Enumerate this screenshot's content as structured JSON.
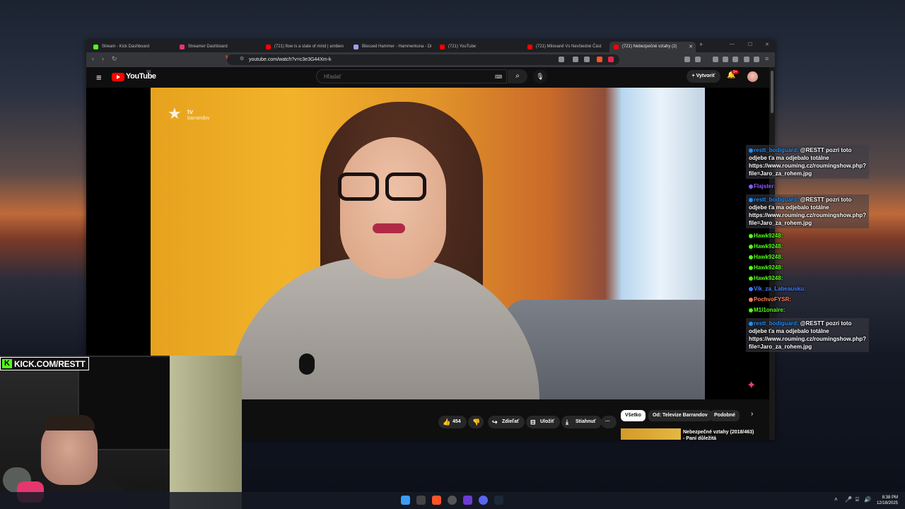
{
  "tabs": [
    {
      "label": "Stream - Kick Dashboard",
      "color": "#53fc18"
    },
    {
      "label": "Streamer Dashboard",
      "color": "#e5366e"
    },
    {
      "label": "(721) flow is a state of mind | ambien",
      "color": "#ff0000"
    },
    {
      "label": "Blessed Hammer - Hammerkuna - Di",
      "color": "#9aa0ff"
    },
    {
      "label": "(721) YouTube",
      "color": "#ff0000"
    },
    {
      "label": "(721) Milovaně Vs Nevšiedné Část",
      "color": "#ff0000"
    },
    {
      "label": "(721) Nebezpečné vztahy (2(",
      "color": "#ff0000"
    }
  ],
  "browser": {
    "url": "youtube.com/watch?v=c3e3G44Xm-k"
  },
  "youtube": {
    "brand": "YouTube",
    "region": "SK",
    "search_placeholder": "Hľadať",
    "create_label": "Vytvoriť",
    "notif_count": "9+"
  },
  "video": {
    "channel_logo": "tv",
    "channel_name": "barrandov",
    "like_count": "454",
    "share_label": "Zdieľať",
    "save_label": "Uložiť",
    "download_label": "Stiahnuť",
    "more_label": "···"
  },
  "chips": [
    "Všetko",
    "Od: Televize Barrandov",
    "Podobné"
  ],
  "recommended": {
    "title": "Nebezpečné vztahy (2018/463)",
    "subtitle": "- Paní důležitá"
  },
  "chat": [
    {
      "user": "restt_bodiguard:",
      "text": "@RESTT pozri toto odjebe ťa ma odjebalo totálne https://www.rouming.cz/roumingshow.php?file=Jaro_za_rohem.jpg",
      "color": "#1e90ff",
      "boxed": true
    },
    {
      "user": "Flajster:",
      "text": "",
      "color": "#8a5cf6",
      "boxed": false
    },
    {
      "user": "restt_bodiguard:",
      "text": "@RESTT pozri toto odjebe ťa ma odjebalo totálne https://www.rouming.cz/roumingshow.php?file=Jaro_za_rohem.jpg",
      "color": "#1e90ff",
      "boxed": true
    },
    {
      "user": "Hawk9248:",
      "text": "",
      "color": "#53fc18",
      "boxed": false
    },
    {
      "user": "Hawk9248:",
      "text": "",
      "color": "#53fc18",
      "boxed": false
    },
    {
      "user": "Hawk9248:",
      "text": "",
      "color": "#53fc18",
      "boxed": false
    },
    {
      "user": "Hawk9248:",
      "text": "",
      "color": "#53fc18",
      "boxed": false
    },
    {
      "user": "Hawk9248:",
      "text": "",
      "color": "#53fc18",
      "boxed": false
    },
    {
      "user": "Vik_za_Labeausku:",
      "text": "",
      "color": "#3f7fff",
      "boxed": false
    },
    {
      "user": "PochvoFYSR:",
      "text": "",
      "color": "#ff7f50",
      "boxed": false
    },
    {
      "user": "M1l1onaire:",
      "text": "",
      "color": "#53fc18",
      "boxed": false
    },
    {
      "user": "restt_bodiguard:",
      "text": "@RESTT pozri toto odjebe ťa ma odjebalo totálne https://www.rouming.cz/roumingshow.php?file=Jaro_za_rohem.jpg",
      "color": "#1e90ff",
      "boxed": true
    }
  ],
  "stream": {
    "tag": "KICK.COM/RESTT"
  },
  "taskbar": {
    "time": "8:38 PM",
    "date": "12/18/2025"
  }
}
